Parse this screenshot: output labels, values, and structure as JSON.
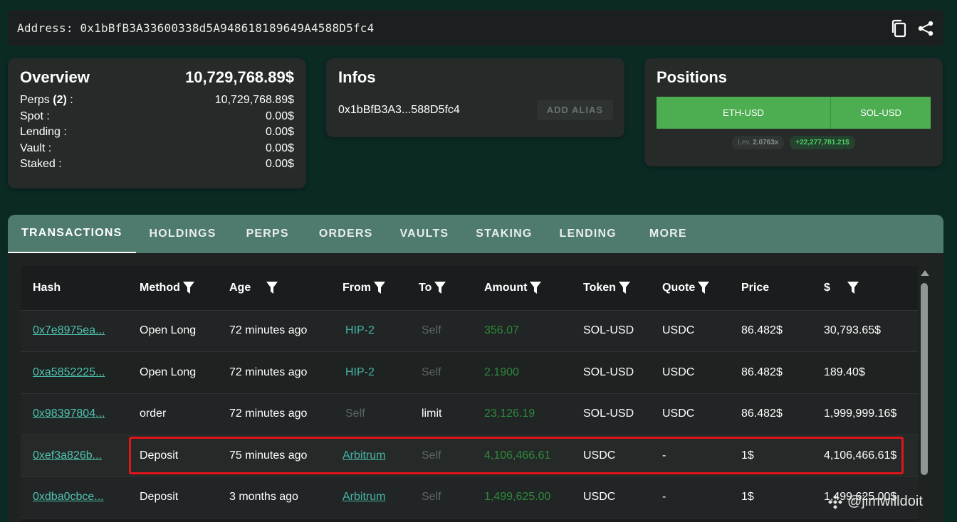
{
  "address_bar": {
    "label": "Address: 0x1bBfB3A33600338d5A948618189649A4588D5fc4",
    "copy_icon": "copy-icon",
    "share_icon": "share-icon"
  },
  "overview": {
    "title": "Overview",
    "total": "10,729,768.89$",
    "rows": [
      {
        "label": "Perps",
        "count": "(2)",
        "suffix": " :",
        "value": "10,729,768.89$"
      },
      {
        "label": "Spot :",
        "value": "0.00$"
      },
      {
        "label": "Lending :",
        "value": "0.00$"
      },
      {
        "label": "Vault :",
        "value": "0.00$"
      },
      {
        "label": "Staked :",
        "value": "0.00$"
      }
    ]
  },
  "infos": {
    "title": "Infos",
    "short_address": "0x1bBfB3A3...588D5fc4",
    "add_alias_label": "ADD ALIAS"
  },
  "positions": {
    "title": "Positions",
    "segments": [
      {
        "label": "ETH-USD"
      },
      {
        "label": "SOL-USD"
      }
    ],
    "leverage_label": "Lev.",
    "leverage_value": "2.0763x",
    "pnl": "+22,277,781.21$",
    "accent_color": "#4cae50"
  },
  "tabs": [
    "TRANSACTIONS",
    "HOLDINGS",
    "PERPS",
    "ORDERS",
    "VAULTS",
    "STAKING",
    "LENDING",
    "MORE"
  ],
  "active_tab": "TRANSACTIONS",
  "table": {
    "columns": [
      "Hash",
      "Method",
      "Age",
      "From",
      "To",
      "Amount",
      "Token",
      "Quote",
      "Price",
      "$"
    ],
    "rows": [
      {
        "hash": "0x7e8975ea...",
        "method": "Open Long",
        "age": "72 minutes ago",
        "from": "HIP-2",
        "to": "Self",
        "amount": "356.07",
        "token": "SOL-USD",
        "quote": "USDC",
        "price": "86.482$",
        "usd": "30,793.65$"
      },
      {
        "hash": "0xa5852225...",
        "method": "Open Long",
        "age": "72 minutes ago",
        "from": "HIP-2",
        "to": "Self",
        "amount": "2.1900",
        "token": "SOL-USD",
        "quote": "USDC",
        "price": "86.482$",
        "usd": "189.40$"
      },
      {
        "hash": "0x98397804...",
        "method": "order",
        "age": "72 minutes ago",
        "from": "Self",
        "to": "limit",
        "amount": "23,126.19",
        "token": "SOL-USD",
        "quote": "USDC",
        "price": "86.482$",
        "usd": "1,999,999.16$"
      },
      {
        "hash": "0xef3a826b...",
        "method": "Deposit",
        "age": "75 minutes ago",
        "from": "Arbitrum",
        "to": "Self",
        "amount": "4,106,466.61",
        "token": "USDC",
        "quote": "-",
        "price": "1$",
        "usd": "4,106,466.61$"
      },
      {
        "hash": "0xdba0cbce...",
        "method": "Deposit",
        "age": "3 months ago",
        "from": "Arbitrum",
        "to": "Self",
        "amount": "1,499,625.00",
        "token": "USDC",
        "quote": "-",
        "price": "1$",
        "usd": "1,499,625.00$"
      }
    ]
  },
  "highlight_color": "#e0141a",
  "watermark": "@jimwilldoit"
}
